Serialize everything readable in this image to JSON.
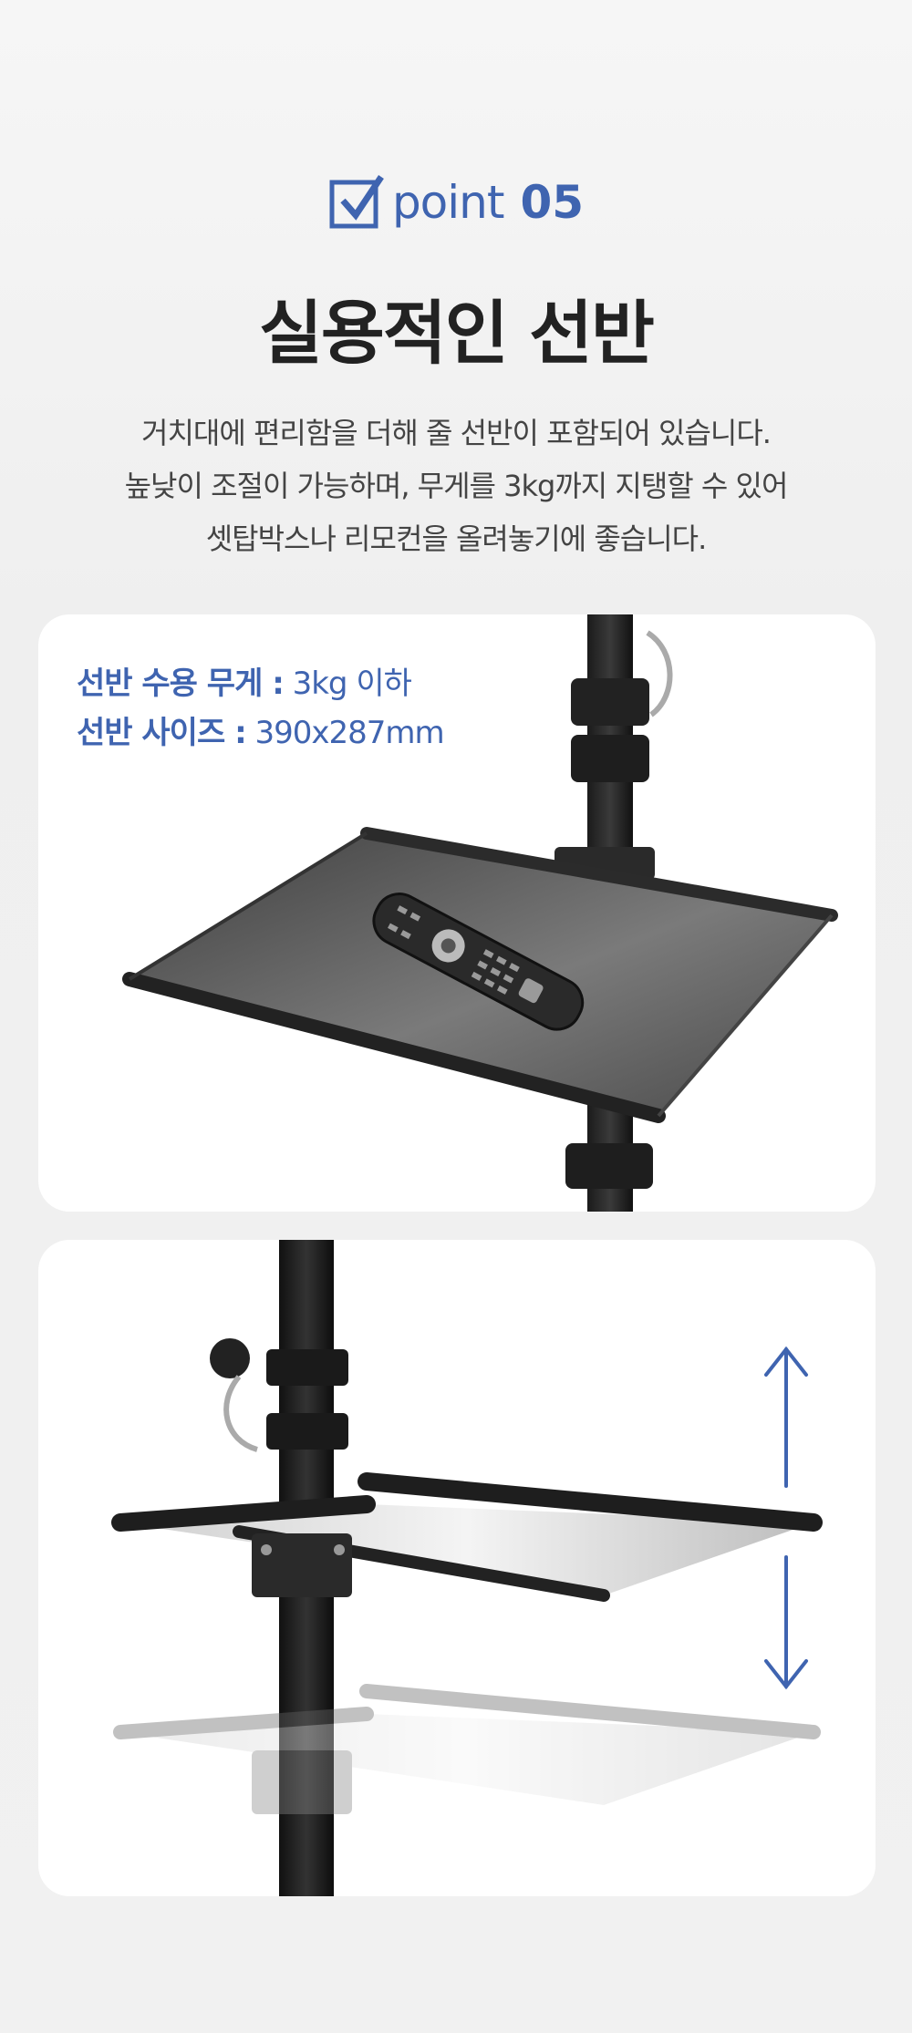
{
  "badge": {
    "word": "point",
    "number": "05"
  },
  "title": "실용적인 선반",
  "description": [
    "거치대에 편리함을 더해 줄 선반이 포함되어 있습니다.",
    "높낮이 조절이 가능하며, 무게를 3kg까지 지탱할 수 있어",
    "셋탑박스나 리모컨을 올려놓기에 좋습니다."
  ],
  "specs": [
    {
      "label": "선반 수용 무게 :",
      "value": " 3kg 이하"
    },
    {
      "label": "선반 사이즈 :",
      "value": " 390x287mm"
    }
  ],
  "colors": {
    "accent": "#3f64b0",
    "card": "#ffffff",
    "background": "#f3f3f3"
  },
  "icons": [
    "checkbox-icon",
    "up-arrow-icon",
    "down-arrow-icon"
  ]
}
